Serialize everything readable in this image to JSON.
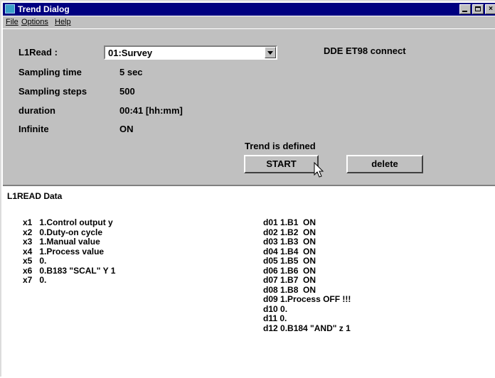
{
  "window": {
    "title": "Trend Dialog",
    "controls": [
      "_",
      "□",
      "×"
    ]
  },
  "menu": {
    "file": "File",
    "options": "Options",
    "help": "Help"
  },
  "form": {
    "read_label": "L1Read :",
    "read_value": "01:Survey",
    "dde_status": "DDE ET98  connect",
    "sampling_time_label": "Sampling time",
    "sampling_time_value": "5 sec",
    "sampling_steps_label": "Sampling steps",
    "sampling_steps_value": "500",
    "duration_label": "duration",
    "duration_value": "00:41 [hh:mm]",
    "infinite_label": "Infinite",
    "infinite_value": "ON",
    "trend_status": "Trend is defined",
    "start_label": "START",
    "delete_label": "delete"
  },
  "data_section": {
    "title": "L1READ Data",
    "x_items": [
      {
        "id": "x1",
        "text": "1.Control output y"
      },
      {
        "id": "x2",
        "text": "0.Duty-on cycle"
      },
      {
        "id": "x3",
        "text": "1.Manual value"
      },
      {
        "id": "x4",
        "text": "1.Process value"
      },
      {
        "id": "x5",
        "text": "0."
      },
      {
        "id": "x6",
        "text": "0.B183 \"SCAL\" Y 1"
      },
      {
        "id": "x7",
        "text": "0."
      }
    ],
    "d_items": [
      {
        "id": "d01",
        "text": "1.B1  ON"
      },
      {
        "id": "d02",
        "text": "1.B2  ON"
      },
      {
        "id": "d03",
        "text": "1.B3  ON"
      },
      {
        "id": "d04",
        "text": "1.B4  ON"
      },
      {
        "id": "d05",
        "text": "1.B5  ON"
      },
      {
        "id": "d06",
        "text": "1.B6  ON"
      },
      {
        "id": "d07",
        "text": "1.B7  ON"
      },
      {
        "id": "d08",
        "text": "1.B8  ON"
      },
      {
        "id": "d09",
        "text": "1.Process OFF !!!"
      },
      {
        "id": "d10",
        "text": "0."
      },
      {
        "id": "d11",
        "text": "0."
      },
      {
        "id": "d12",
        "text": "0.B184 \"AND\" z 1"
      }
    ]
  }
}
